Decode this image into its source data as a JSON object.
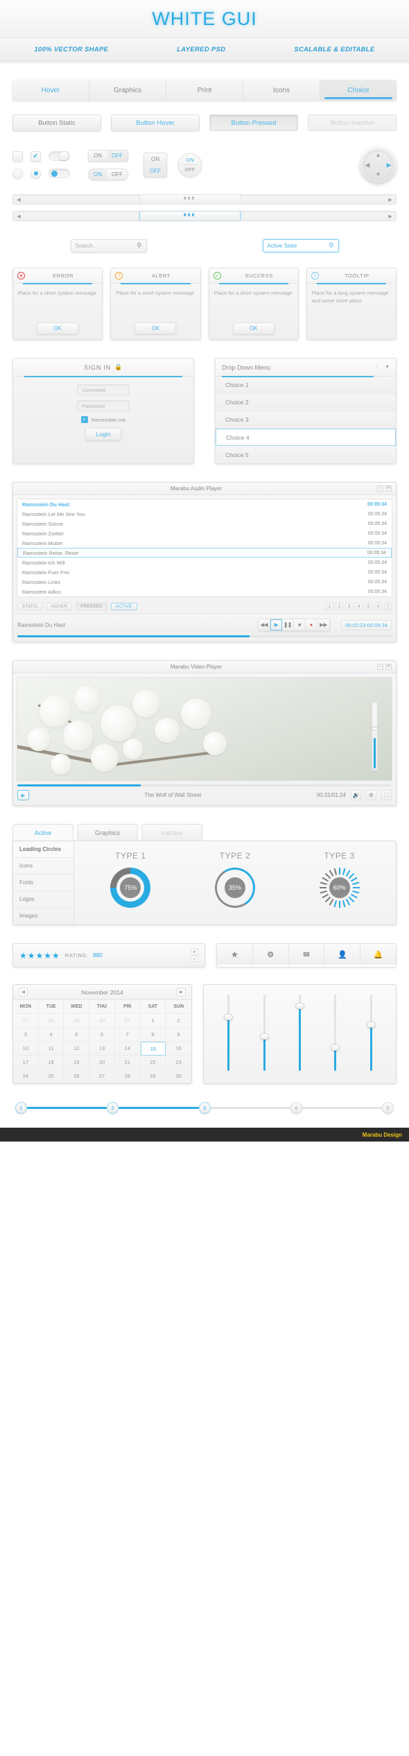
{
  "header": {
    "title": "WHITE GUI",
    "features": [
      "100% VECTOR SHAPE",
      "LAYERED PSD",
      "SCALABLE & EDITABLE"
    ]
  },
  "tabs": [
    {
      "label": "Hover",
      "state": "lit"
    },
    {
      "label": "Graphics",
      "state": "normal"
    },
    {
      "label": "Print",
      "state": "normal"
    },
    {
      "label": "Icons",
      "state": "normal"
    },
    {
      "label": "Choice",
      "state": "selected"
    }
  ],
  "buttons": [
    {
      "label": "Button Static",
      "state": "static"
    },
    {
      "label": "Button Hover",
      "state": "hover"
    },
    {
      "label": "Button Pressed",
      "state": "pressed"
    },
    {
      "label": "Button Inactive",
      "state": "inactive"
    }
  ],
  "toggles": {
    "on_label": "ON",
    "off_label": "OFF",
    "check_glyph": "✔"
  },
  "search": {
    "placeholder": "Search...",
    "active_value": "Active State",
    "icon": "search-icon"
  },
  "messages": [
    {
      "title": "ERROR",
      "icon": "error-icon",
      "glyph": "✕",
      "body": "Place for a short system message",
      "button": "OK"
    },
    {
      "title": "ALERT",
      "icon": "alert-icon",
      "glyph": "!",
      "body": "Place for a short system message",
      "button": "OK"
    },
    {
      "title": "SUCCESS",
      "icon": "success-icon",
      "glyph": "✓",
      "body": "Place for a short system message",
      "button": "OK"
    },
    {
      "title": "TOOLTIP",
      "icon": "info-icon",
      "glyph": "i",
      "body": "Place for a long system message and some more place",
      "button": ""
    }
  ],
  "signin": {
    "title": "SIGN IN",
    "lock_icon": "lock-icon",
    "username_placeholder": "Username",
    "password_placeholder": "Password",
    "remember_label": "Remember me",
    "login_label": "Login"
  },
  "dropdown": {
    "label": "Drop Down Menu",
    "chevron": "▼",
    "options": [
      "Choice 1",
      "Choice 2",
      "Choice 3",
      "Choice 4",
      "Choice 5"
    ],
    "selected": "Choice 4"
  },
  "audio_player": {
    "title": "Marabu Audio Player",
    "tracks": [
      {
        "name": "Ramsstein Du Hast",
        "time": "00:05:34",
        "state": "playing"
      },
      {
        "name": "Ramsstein Let Me See You",
        "time": "00:05:34",
        "state": "normal"
      },
      {
        "name": "Ramsstein Sonne",
        "time": "00:05:34",
        "state": "normal"
      },
      {
        "name": "Ramsstein Zwitter",
        "time": "00:05:34",
        "state": "normal"
      },
      {
        "name": "Ramsstein Mutter",
        "time": "00:05:34",
        "state": "normal"
      },
      {
        "name": "Ramsstein Reise, Reise",
        "time": "00:05:34",
        "state": "selected"
      },
      {
        "name": "Ramsstein Ich Will",
        "time": "00:05:34",
        "state": "normal"
      },
      {
        "name": "Ramsstein Fuer Frei",
        "time": "00:05:34",
        "state": "normal"
      },
      {
        "name": "Ramsstein Links",
        "time": "00:05:34",
        "state": "normal"
      },
      {
        "name": "Ramsstein Adios",
        "time": "00:05:34",
        "state": "normal"
      }
    ],
    "chips": [
      "STATIC",
      "HOVER",
      "PRESSED",
      "ACTIVE"
    ],
    "pages": [
      "1",
      "2",
      "3",
      "4",
      "5",
      "6",
      "7"
    ],
    "now_playing": "Ramsstein Du Hast",
    "time_display": "00:02:23-00:05:34",
    "controls": [
      "prev",
      "play",
      "pause",
      "stop",
      "record",
      "next"
    ],
    "progress_percent": 62,
    "window_buttons": [
      "–",
      "✕"
    ]
  },
  "video_player": {
    "title": "Marabu Video Player",
    "movie_title": "The Wolf of Wall Street",
    "time": "00:31/01:24",
    "progress_percent": 33,
    "volume_percent": 45,
    "play_icon": "play-icon",
    "speaker_icon": "speaker-icon",
    "settings_icon": "gear-icon",
    "fullscreen_icon": "fullscreen-icon",
    "window_buttons": [
      "–",
      "✕"
    ]
  },
  "loading_panel": {
    "tabs": [
      {
        "label": "Active",
        "state": "active"
      },
      {
        "label": "Graphics",
        "state": "normal"
      },
      {
        "label": "Inactive",
        "state": "inactive"
      }
    ],
    "sidebar": [
      "Loading Circles",
      "Icons",
      "Fonts",
      "Logos",
      "Images"
    ]
  },
  "chart_data": {
    "type": "pie",
    "title": "Loading Circles",
    "series": [
      {
        "name": "TYPE 1",
        "value": 75,
        "label": "75%",
        "style": "segmented-donut",
        "color": "#29abe2",
        "track_color": "#7a7a7a"
      },
      {
        "name": "TYPE 2",
        "value": 35,
        "label": "35%",
        "style": "thin-ring",
        "color": "#29abe2",
        "track_color": "#8c8c8c"
      },
      {
        "name": "TYPE 3",
        "value": 60,
        "label": "60%",
        "style": "radial-ticks",
        "color": "#29abe2",
        "track_color": "#7a7a7a"
      }
    ],
    "categories": [
      "TYPE 1",
      "TYPE 2",
      "TYPE 3"
    ],
    "values": [
      75,
      35,
      60
    ],
    "ylim": [
      0,
      100
    ]
  },
  "rating": {
    "stars_filled": 5,
    "star_glyph": "★",
    "label": "RATING:",
    "value": "880",
    "plus": "+",
    "minus": "–"
  },
  "icon_buttons": [
    {
      "icon": "star-icon",
      "glyph": "★"
    },
    {
      "icon": "gear-icon",
      "glyph": "⚙"
    },
    {
      "icon": "mail-icon",
      "glyph": "✉"
    },
    {
      "icon": "user-icon",
      "glyph": "♟"
    },
    {
      "icon": "bell-icon",
      "glyph": "✉"
    }
  ],
  "calendar": {
    "month": "November 2014",
    "prev_icon": "chevron-left-icon",
    "next_icon": "chevron-right-icon",
    "dow": [
      "MON",
      "TUE",
      "WED",
      "THU",
      "FRI",
      "SAT",
      "SUN"
    ],
    "selected_day": "15",
    "weeks": [
      [
        {
          "d": "27",
          "mut": true
        },
        {
          "d": "28",
          "mut": true
        },
        {
          "d": "29",
          "mut": true
        },
        {
          "d": "30",
          "mut": true
        },
        {
          "d": "31",
          "mut": true
        },
        {
          "d": "1"
        },
        {
          "d": "2"
        }
      ],
      [
        {
          "d": "3"
        },
        {
          "d": "4"
        },
        {
          "d": "5"
        },
        {
          "d": "6"
        },
        {
          "d": "7"
        },
        {
          "d": "8"
        },
        {
          "d": "9"
        }
      ],
      [
        {
          "d": "10"
        },
        {
          "d": "11"
        },
        {
          "d": "12"
        },
        {
          "d": "13"
        },
        {
          "d": "14"
        },
        {
          "d": "15",
          "sel": true
        },
        {
          "d": "16"
        }
      ],
      [
        {
          "d": "17"
        },
        {
          "d": "18"
        },
        {
          "d": "19"
        },
        {
          "d": "20"
        },
        {
          "d": "21"
        },
        {
          "d": "22"
        },
        {
          "d": "23"
        }
      ],
      [
        {
          "d": "24"
        },
        {
          "d": "25"
        },
        {
          "d": "26"
        },
        {
          "d": "27"
        },
        {
          "d": "28"
        },
        {
          "d": "29"
        },
        {
          "d": "30"
        }
      ]
    ]
  },
  "sliders": {
    "vertical_values": [
      70,
      45,
      85,
      30,
      60
    ],
    "horizontal_value": 40
  },
  "steps": [
    {
      "label": "1",
      "state": "on"
    },
    {
      "label": "2",
      "state": "on"
    },
    {
      "label": "3",
      "state": "on"
    },
    {
      "label": "4",
      "state": "off"
    },
    {
      "label": "5",
      "state": "off"
    }
  ],
  "footer": {
    "credit": "Marabu Design"
  }
}
